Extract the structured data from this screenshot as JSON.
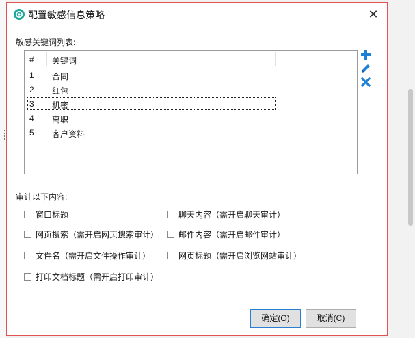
{
  "dialog": {
    "title": "配置敏感信息策略",
    "close_label": "✕"
  },
  "keywords": {
    "label": "敏感关键词列表:",
    "columns": [
      "#",
      "关键词"
    ],
    "rows": [
      {
        "num": "1",
        "keyword": "合同"
      },
      {
        "num": "2",
        "keyword": "红包"
      },
      {
        "num": "3",
        "keyword": "机密"
      },
      {
        "num": "4",
        "keyword": "离职"
      },
      {
        "num": "5",
        "keyword": "客户资料"
      }
    ],
    "focused_row": 3
  },
  "tools": {
    "add_icon": "plus-icon",
    "edit_icon": "pencil-icon",
    "delete_icon": "cross-icon",
    "accent_color": "#1e7fd6"
  },
  "audit": {
    "label": "审计以下内容:",
    "options": [
      {
        "label": "窗口标题",
        "checked": false
      },
      {
        "label": "聊天内容（需开启聊天审计）",
        "checked": false
      },
      {
        "label": "网页搜索（需开启网页搜索审计）",
        "checked": false
      },
      {
        "label": "邮件内容（需开启邮件审计）",
        "checked": false
      },
      {
        "label": "文件名（需开启文件操作审计）",
        "checked": false
      },
      {
        "label": "网页标题（需开启浏览网站审计）",
        "checked": false
      },
      {
        "label": "打印文档标题（需开启打印审计）",
        "checked": false
      }
    ]
  },
  "buttons": {
    "ok": "确定(O)",
    "cancel": "取消(C)"
  }
}
